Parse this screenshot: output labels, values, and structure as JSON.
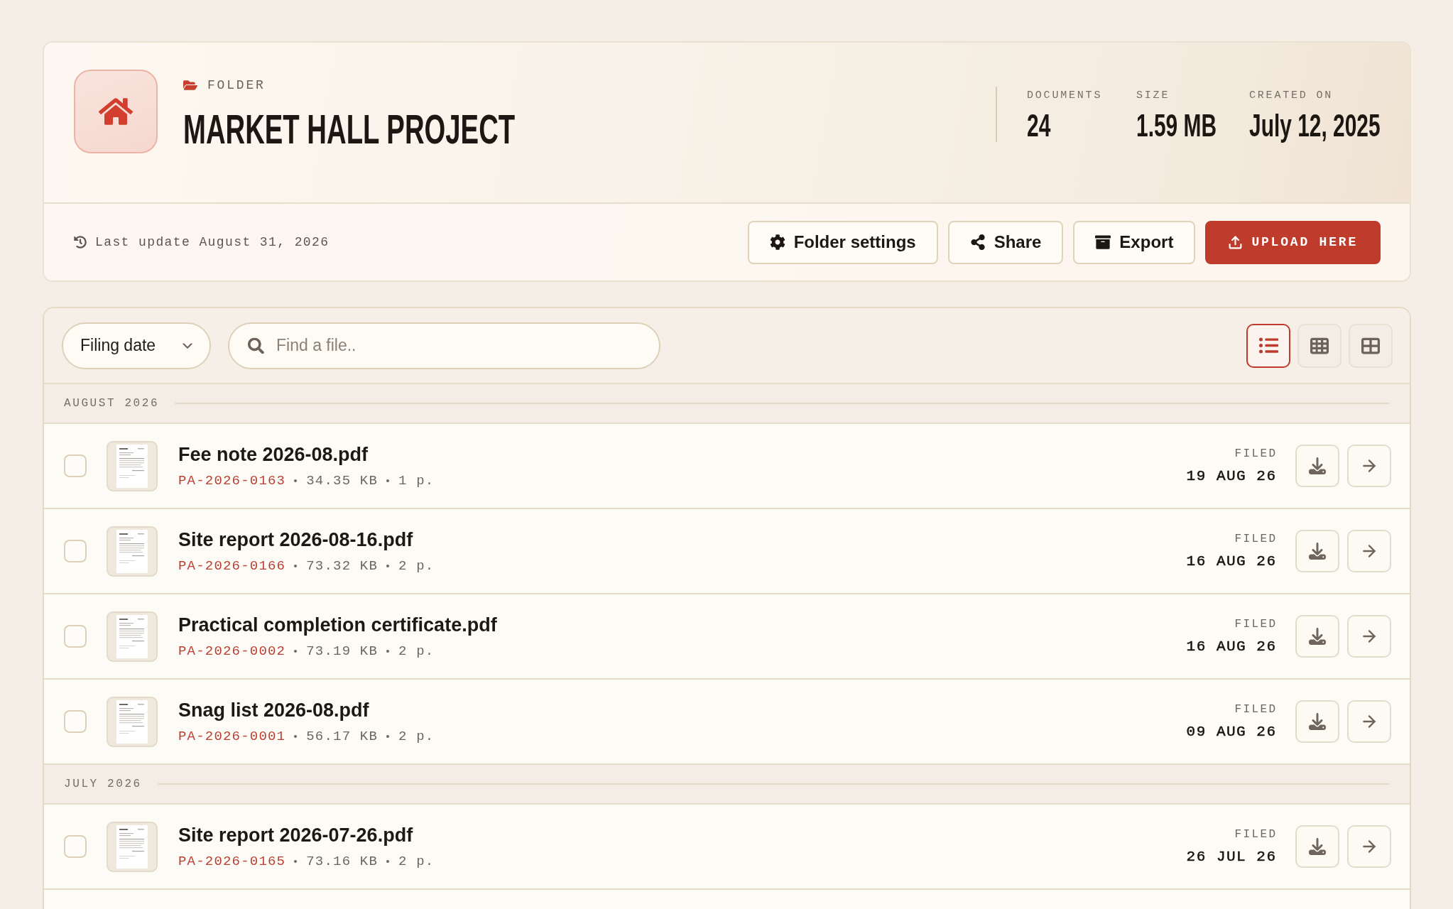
{
  "header": {
    "label": "FOLDER",
    "title": "MARKET HALL PROJECT",
    "stats": [
      {
        "label": "DOCUMENTS",
        "value": "24"
      },
      {
        "label": "SIZE",
        "value": "1.59 MB"
      },
      {
        "label": "CREATED ON",
        "value": "July 12, 2025"
      }
    ],
    "last_update": "Last update August 31, 2026",
    "actions": [
      {
        "kind": "settings",
        "label": "Folder settings"
      },
      {
        "kind": "share",
        "label": "Share"
      },
      {
        "kind": "export",
        "label": "Export"
      },
      {
        "kind": "upload",
        "label": "UPLOAD HERE"
      }
    ]
  },
  "toolbar": {
    "sort": {
      "value": "Filing date"
    },
    "search": {
      "placeholder": "Find a file.."
    },
    "views": [
      {
        "kind": "list",
        "selected": true
      },
      {
        "kind": "grid",
        "selected": false
      },
      {
        "kind": "tiles",
        "selected": false
      }
    ]
  },
  "groups": [
    {
      "title": "AUGUST 2026",
      "files": [
        {
          "name": "Fee note 2026-08.pdf",
          "reference": "PA-2026-0163",
          "size": "34.35 KB",
          "pages": "1 p.",
          "filed_label": "FILED",
          "filed_date": "19 AUG 26",
          "checked": false
        },
        {
          "name": "Site report 2026-08-16.pdf",
          "reference": "PA-2026-0166",
          "size": "73.32 KB",
          "pages": "2 p.",
          "filed_label": "FILED",
          "filed_date": "16 AUG 26",
          "checked": false
        },
        {
          "name": "Practical completion certificate.pdf",
          "reference": "PA-2026-0002",
          "size": "73.19 KB",
          "pages": "2 p.",
          "filed_label": "FILED",
          "filed_date": "16 AUG 26",
          "checked": false
        },
        {
          "name": "Snag list 2026-08.pdf",
          "reference": "PA-2026-0001",
          "size": "56.17 KB",
          "pages": "2 p.",
          "filed_label": "FILED",
          "filed_date": "09 AUG 26",
          "checked": false
        }
      ]
    },
    {
      "title": "JULY 2026",
      "files": [
        {
          "name": "Site report 2026-07-26.pdf",
          "reference": "PA-2026-0165",
          "size": "73.16 KB",
          "pages": "2 p.",
          "filed_label": "FILED",
          "filed_date": "26 JUL 26",
          "checked": false
        }
      ]
    }
  ]
}
